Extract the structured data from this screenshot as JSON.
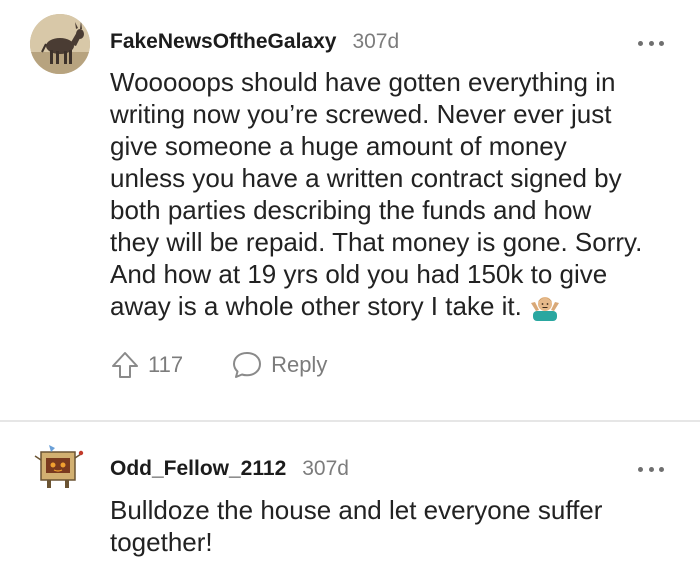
{
  "comments": [
    {
      "username": "FakeNewsOftheGalaxy",
      "age": "307d",
      "avatar_icon": "donkey-avatar",
      "body": "Wooooops should have gotten everything in\nwriting now you’re screwed. Never ever just\ngive someone a huge amount of money\nunless you have a written contract signed by\nboth parties describing the funds and how\nthey will be repaid. That money is gone. Sorry.\nAnd how at 19 yrs old you had 150k to give\naway is a whole other story I take it.",
      "emoji_icon": "person-shrugging-emoji",
      "upvotes": "117",
      "reply_label": "Reply"
    },
    {
      "username": "Odd_Fellow_2112",
      "age": "307d",
      "avatar_icon": "box-robot-avatar",
      "body": "Bulldoze the house and let everyone suffer\ntogether!"
    }
  ],
  "colors": {
    "text": "#1c1c1c",
    "muted": "#7c7c7c",
    "divider": "#e6e6e6"
  }
}
